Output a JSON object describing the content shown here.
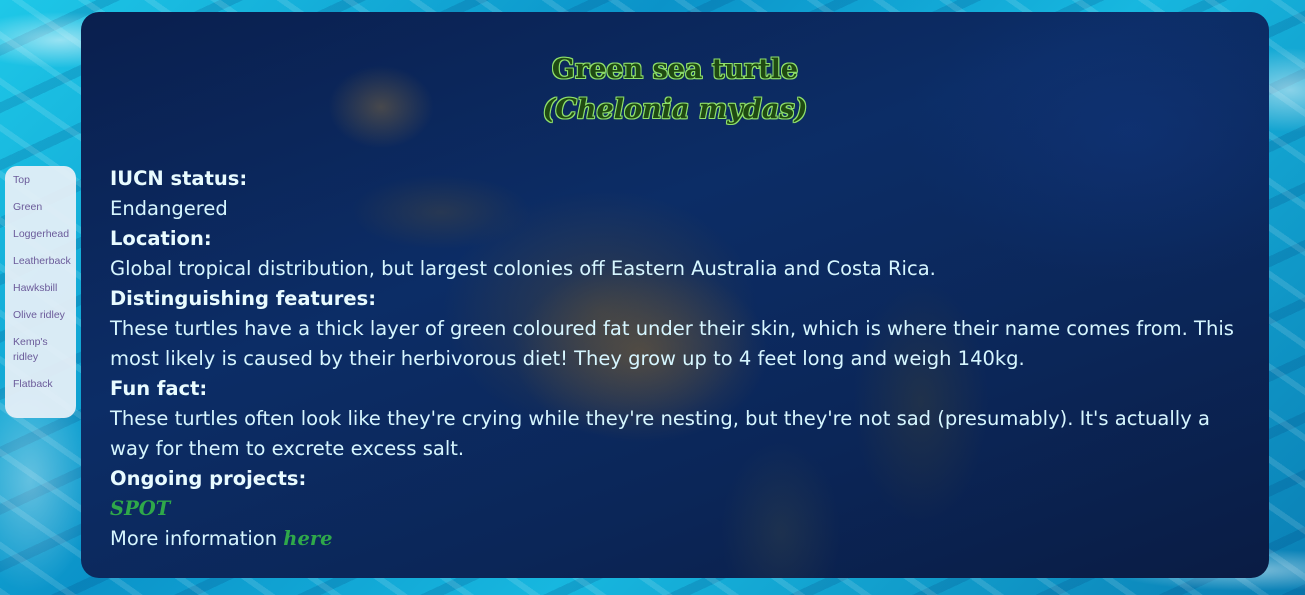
{
  "nav": {
    "items": [
      {
        "label": "Top"
      },
      {
        "label": "Green"
      },
      {
        "label": "Loggerhead"
      },
      {
        "label": "Leatherback"
      },
      {
        "label": "Hawksbill"
      },
      {
        "label": "Olive ridley"
      },
      {
        "label": "Kemp's ridley"
      },
      {
        "label": "Flatback"
      }
    ]
  },
  "species": {
    "common_name": "Green sea turtle",
    "scientific_name": "(Chelonia mydas)",
    "sections": {
      "iucn_label": "IUCN status:",
      "iucn_value": "Endangered",
      "location_label": "Location:",
      "location_value": "Global tropical distribution, but largest colonies off Eastern Australia and Costa Rica.",
      "features_label": "Distinguishing features:",
      "features_value": "These turtles have a thick layer of green coloured fat under their skin, which is where their name comes from. This most likely is caused by their herbivorous diet! They grow up to 4 feet long and weigh 140kg.",
      "funfact_label": "Fun fact:",
      "funfact_value": "These turtles often look like they're crying while they're nesting, but they're not sad (presumably). It's actually a way for them to excrete excess salt.",
      "projects_label": "Ongoing projects:",
      "project_name": "SPOT",
      "more_info_prefix": "More information ",
      "more_info_link": "here"
    }
  },
  "colors": {
    "link_green": "#2fa84a",
    "text": "#d6f6ff",
    "panel": "#0b2658",
    "nav_bg": "#e8f0f8",
    "nav_text": "#6b5b9a"
  }
}
